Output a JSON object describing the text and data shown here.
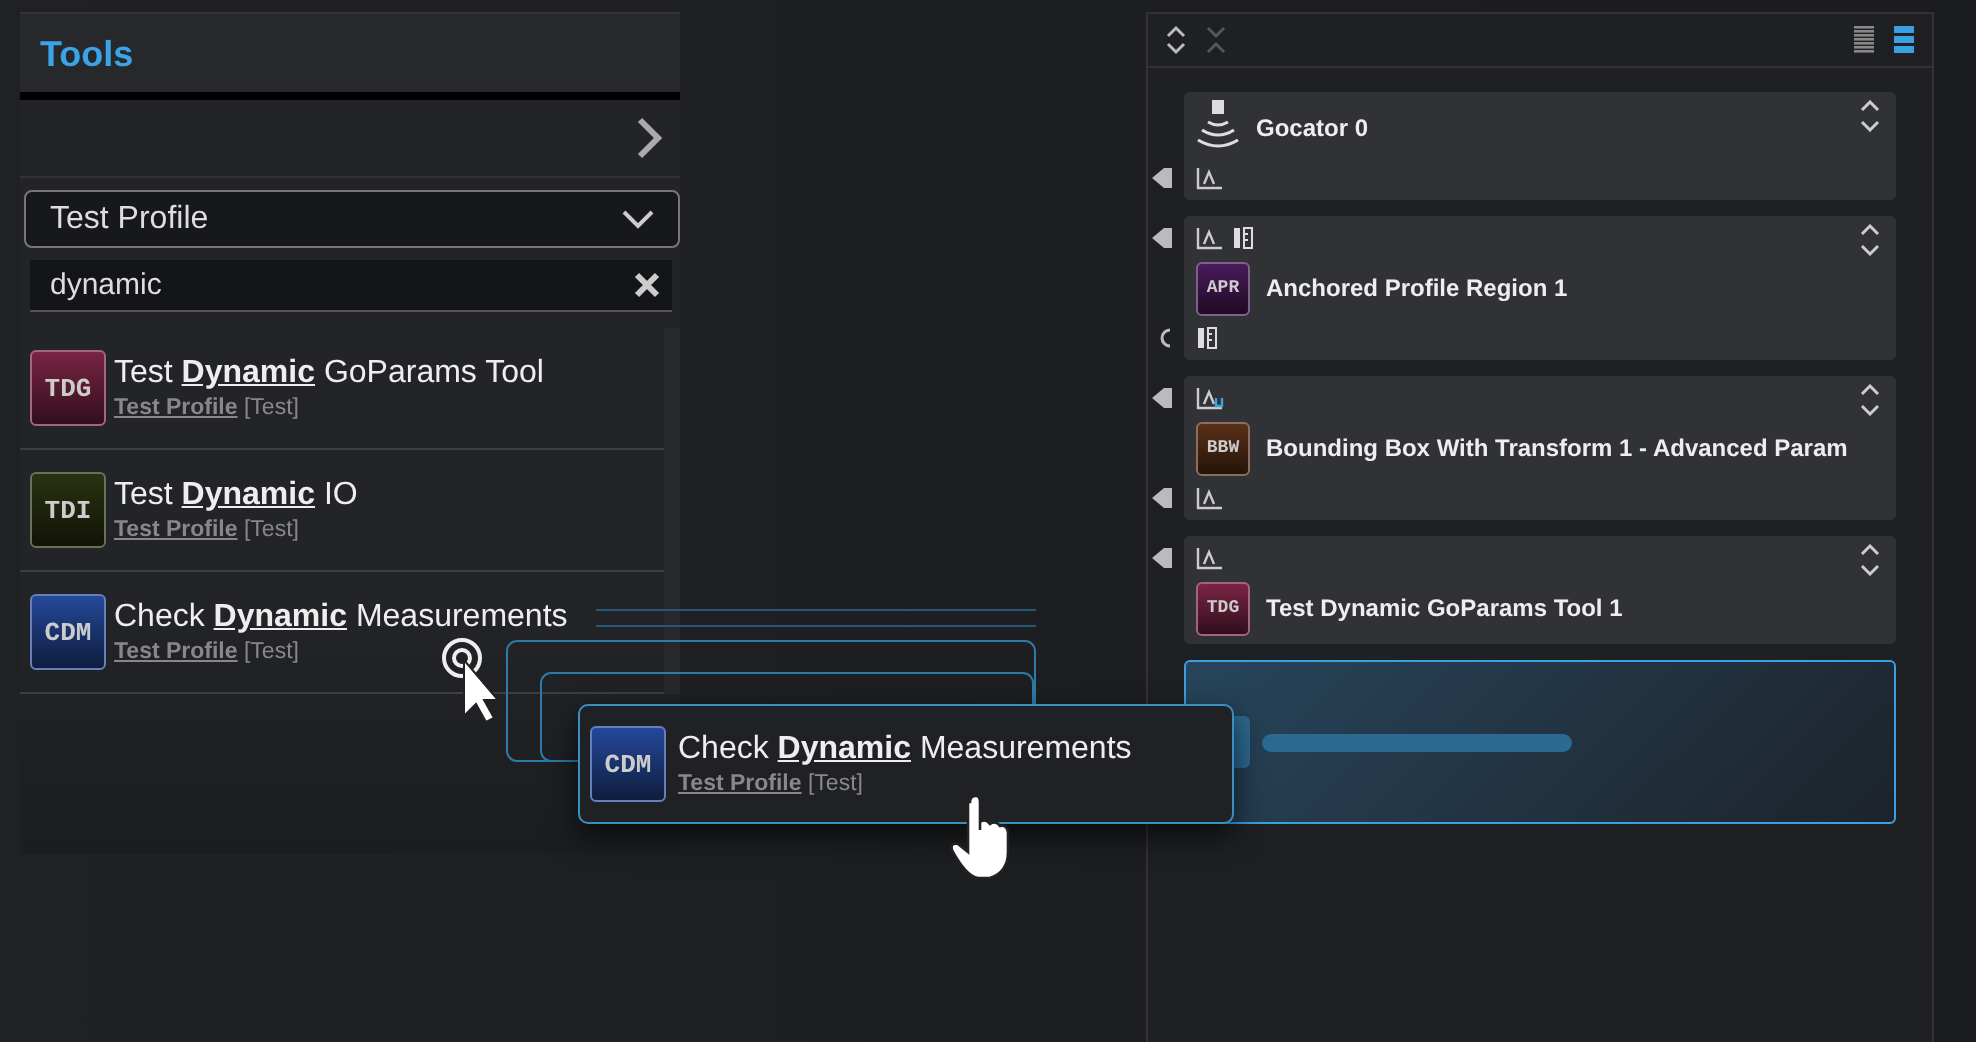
{
  "tools_panel": {
    "title": "Tools",
    "profile_dropdown": {
      "value": "Test Profile"
    },
    "search": {
      "value": "dynamic"
    },
    "results": [
      {
        "badge": "TDG",
        "color": "#7a2444",
        "name": "Test **Dynamic** GoParams Tool",
        "profile": "Test Profile",
        "tag": "[Test]"
      },
      {
        "badge": "TDI",
        "color": "#2a3210",
        "name": "Test **Dynamic** IO",
        "profile": "Test Profile",
        "tag": "[Test]"
      },
      {
        "badge": "CDM",
        "color": "#24489a",
        "name": "Check **Dynamic** Measurements",
        "profile": "Test Profile",
        "tag": "[Test]"
      }
    ]
  },
  "drag_preview": {
    "badge": "CDM",
    "color": "#24489a",
    "name": "Check **Dynamic** Measurements",
    "profile": "Test Profile",
    "tag": "[Test]"
  },
  "pipeline": {
    "view_modes": [
      {
        "selected": false
      },
      {
        "selected": true
      }
    ],
    "nodes": [
      {
        "kind": "sensor",
        "name": "Gocator 0",
        "bottom": {
          "port": {
            "kind": "arrow"
          },
          "icons": [
            {
              "kind": "profile"
            }
          ]
        }
      },
      {
        "kind": "tool",
        "badge": "APR",
        "color": "#4a1a5a",
        "name": "Anchored Profile Region 1",
        "top": {
          "port": {
            "kind": "arrow"
          },
          "icons": [
            {
              "kind": "profile"
            },
            {
              "kind": "measure"
            }
          ]
        },
        "bottom": {
          "port": {
            "kind": "ring"
          },
          "icons": [
            {
              "kind": "measure"
            }
          ]
        }
      },
      {
        "kind": "tool",
        "badge": "BBW",
        "color": "#5a3018",
        "name": "Bounding Box With Transform 1 - Advanced Param",
        "top": {
          "port": {
            "kind": "arrow"
          },
          "icons": [
            {
              "kind": "surface"
            }
          ]
        },
        "bottom": {
          "port": {
            "kind": "arrow"
          },
          "icons": [
            {
              "kind": "profile"
            }
          ]
        }
      },
      {
        "kind": "tool",
        "badge": "TDG",
        "color": "#7a2444",
        "name": "Test Dynamic GoParams Tool 1",
        "top": {
          "port": {
            "kind": "arrow"
          },
          "icons": [
            {
              "kind": "profile"
            }
          ]
        }
      }
    ]
  }
}
